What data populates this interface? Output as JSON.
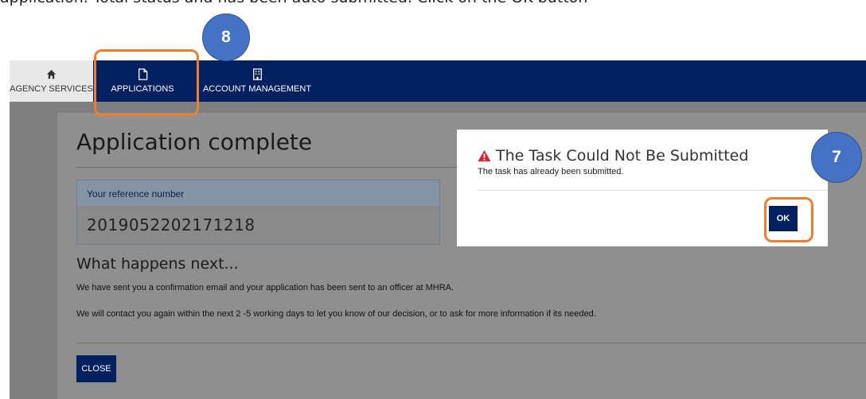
{
  "caption": "application. Total status and has been auto submitted. Click on the OK button",
  "navbar": {
    "items": [
      {
        "label": "AGENCY SERVICES",
        "icon": "home-icon"
      },
      {
        "label": "APPLICATIONS",
        "icon": "document-icon"
      },
      {
        "label": "ACCOUNT MANAGEMENT",
        "icon": "building-icon"
      }
    ]
  },
  "page": {
    "title": "Application complete",
    "reference": {
      "label": "Your reference number",
      "number": "2019052202171218"
    },
    "next_heading": "What happens next...",
    "paragraphs": [
      "We have sent you a confirmation email and your application has been sent to an officer at MHRA.",
      "We will contact you again within the next 2 -5 working days to let you know of our decision, or to ask for more information if its needed."
    ],
    "close_label": "CLOSE"
  },
  "modal": {
    "title": "The Task Could Not Be Submitted",
    "message": "The task has already been submitted.",
    "ok_label": "OK",
    "icon": "warning-icon"
  },
  "annotations": {
    "step_apps": "8",
    "step_ok": "7",
    "highlight_color": "#ED7D31",
    "badge_color": "#4472C4"
  },
  "colors": {
    "navy": "#002060",
    "warning": "#d9232e"
  }
}
